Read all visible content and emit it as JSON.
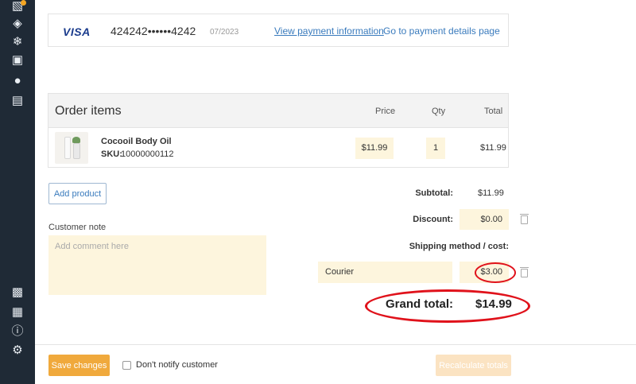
{
  "sidebar": {
    "top_icons": [
      "user-plus-icon",
      "tags-icon",
      "snowflake-icon",
      "gift-icon",
      "users-icon",
      "newspaper-icon"
    ],
    "bottom_icons": [
      "puzzle-icon",
      "image-icon",
      "info-icon",
      "gear-icon"
    ]
  },
  "payment": {
    "brand": "VISA",
    "card_number": "424242••••••4242",
    "expiry": "07/2023",
    "view_link": "View payment information",
    "details_link": "Go to payment details page"
  },
  "order": {
    "title": "Order items",
    "columns": {
      "price": "Price",
      "qty": "Qty",
      "total": "Total"
    },
    "items": [
      {
        "name": "Cocooil Body Oil",
        "sku_label": "SKU:",
        "sku": "10000000112",
        "price": "$11.99",
        "qty": "1",
        "total": "$11.99"
      }
    ]
  },
  "actions": {
    "add_product": "Add product",
    "save": "Save changes",
    "notify_label": "Don't notify customer",
    "recalculate": "Recalculate totals"
  },
  "note": {
    "label": "Customer note",
    "placeholder": "Add comment here"
  },
  "totals": {
    "subtotal_label": "Subtotal:",
    "subtotal": "$11.99",
    "discount_label": "Discount:",
    "discount": "$0.00",
    "shipping_label": "Shipping method / cost:",
    "shipping_method": "Courier",
    "shipping_cost": "$3.00",
    "grand_label": "Grand total:",
    "grand_total": "$14.99"
  },
  "colors": {
    "accent": "#f0a93c",
    "sidebar": "#1f2a36",
    "highlight": "#e0121b",
    "field": "#fdf5dd"
  }
}
